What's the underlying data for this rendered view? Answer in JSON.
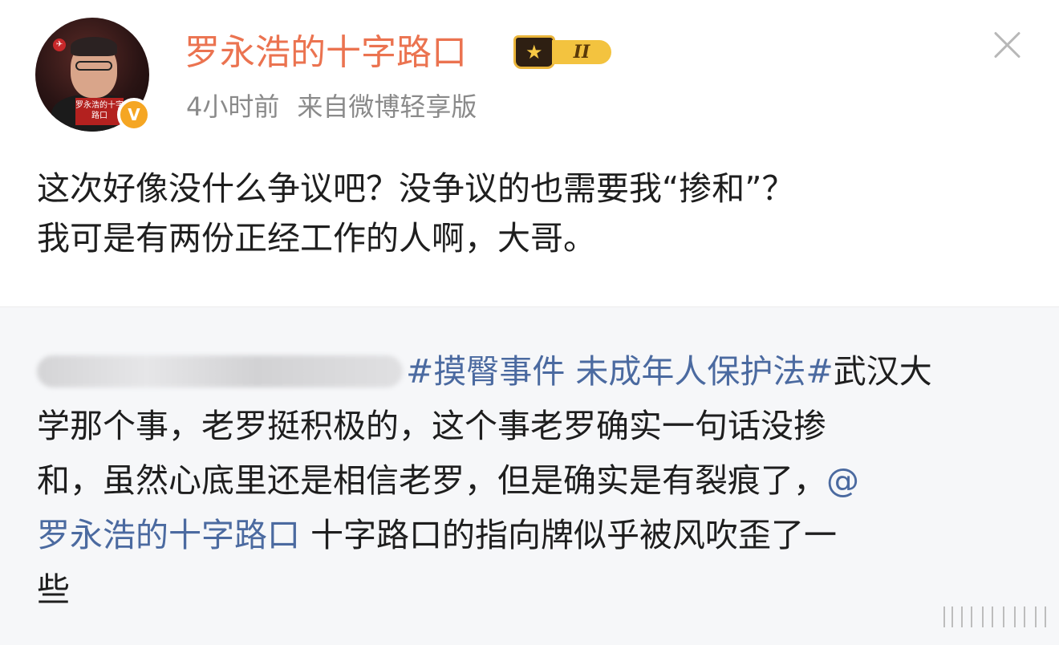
{
  "post": {
    "username": "罗永浩的十字路口",
    "vip_level": "II",
    "verified_mark": "V",
    "avatar_caption": "罗永浩的十字路口",
    "timestamp": "4小时前",
    "source": "来自微博轻享版",
    "text_lines": [
      "这次好像没什么争议吧？没争议的也需要我“掺和”？",
      "我可是有两份正经工作的人啊，大哥。"
    ]
  },
  "repost": {
    "hashtag": "#摸臀事件 未成年人保护法#",
    "line1_tail": "武汉大",
    "line2": "学那个事，老罗挺积极的，这个事老罗确实一句话没掺",
    "line3": "和，虽然心底里还是相信老罗，但是确实是有裂痕了，",
    "mention_at": "@",
    "mention_name": "罗永浩的十字路口",
    "line4_tail": " 十字路口的指向牌似乎被风吹歪了一",
    "line5": "些"
  },
  "colors": {
    "username": "#eb7350",
    "link": "#4b6aa0",
    "meta": "#8a8a8a",
    "repost_bg": "#f6f7f9"
  },
  "icons": [
    "close-icon",
    "vip-crown-icon",
    "verified-icon",
    "watermark-icon"
  ]
}
